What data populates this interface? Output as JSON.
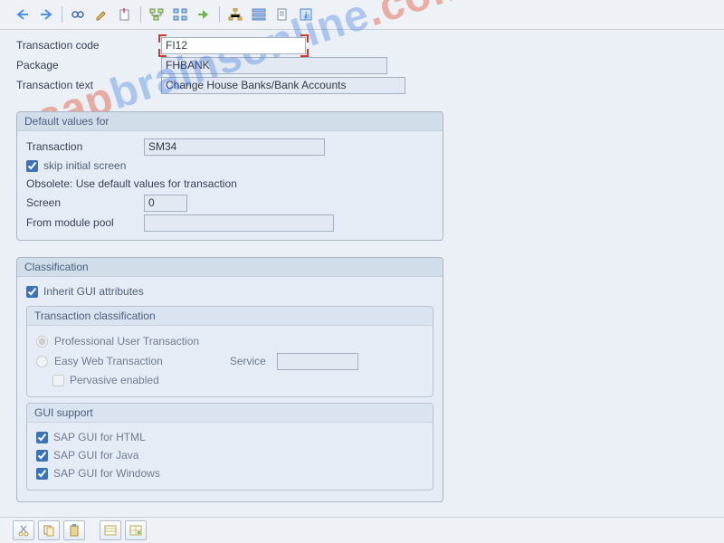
{
  "header": {
    "transaction_code_label": "Transaction code",
    "transaction_code_value": "FI12",
    "package_label": "Package",
    "package_value": "FHBANK",
    "transaction_text_label": "Transaction text",
    "transaction_text_value": "Change House Banks/Bank Accounts"
  },
  "defaults": {
    "title": "Default values for",
    "transaction_label": "Transaction",
    "transaction_value": "SM34",
    "skip_initial_label": "skip initial screen",
    "skip_initial_checked": true,
    "obsolete_text": "Obsolete: Use default values for transaction",
    "screen_label": "Screen",
    "screen_value": "0",
    "module_pool_label": "From module pool",
    "module_pool_value": ""
  },
  "classification": {
    "title": "Classification",
    "inherit_label": "Inherit GUI attributes",
    "inherit_checked": true,
    "sub_title": "Transaction classification",
    "opt_professional": "Professional User Transaction",
    "opt_easy": "Easy Web Transaction",
    "service_label": "Service",
    "service_value": "",
    "pervasive_label": "Pervasive enabled",
    "gui_title": "GUI support",
    "gui_html": "SAP GUI for HTML",
    "gui_java": "SAP GUI for Java",
    "gui_win": "SAP GUI for Windows"
  },
  "toolbar_icons": {
    "back": "back-arrow-icon",
    "forward": "forward-arrow-icon",
    "glasses": "display-icon",
    "pencil": "edit-icon",
    "create": "create-icon",
    "tree1": "where-used-icon",
    "tree2": "object-list-icon",
    "arrow_out": "navigate-icon",
    "hier1": "hierarchy1-icon",
    "hier2": "hierarchy2-icon",
    "doc": "documentation-icon",
    "info": "info-icon"
  },
  "bottom_icons": {
    "cut": "cut-icon",
    "copy": "copy-icon",
    "paste": "paste-icon",
    "list1": "layout1-icon",
    "list2": "layout2-icon"
  }
}
